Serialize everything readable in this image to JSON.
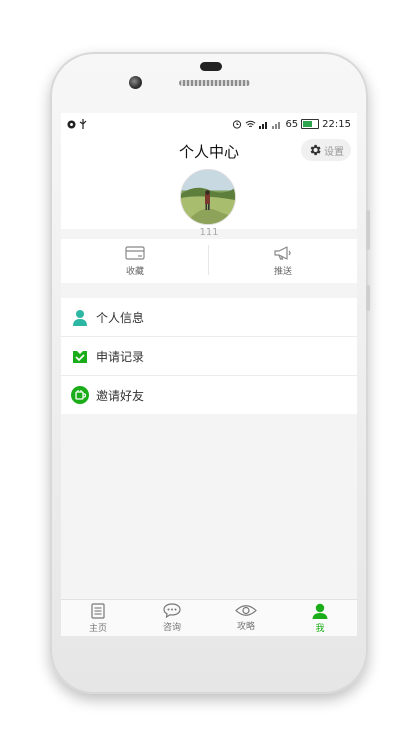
{
  "status_bar": {
    "battery_percent": "65",
    "time": "22:15",
    "battery_level": 0.65
  },
  "header": {
    "title": "个人中心",
    "settings_label": "设置"
  },
  "profile": {
    "username": "111"
  },
  "quick_actions": [
    {
      "label": "收藏",
      "icon": "card-icon"
    },
    {
      "label": "推送",
      "icon": "megaphone-icon"
    }
  ],
  "menu": [
    {
      "label": "个人信息",
      "icon": "person-icon"
    },
    {
      "label": "申请记录",
      "icon": "record-icon"
    },
    {
      "label": "邀请好友",
      "icon": "invite-icon"
    }
  ],
  "tabs": [
    {
      "label": "主页",
      "icon": "document-icon"
    },
    {
      "label": "咨询",
      "icon": "chat-icon"
    },
    {
      "label": "攻略",
      "icon": "eye-icon"
    },
    {
      "label": "我",
      "icon": "user-icon",
      "active": true
    }
  ],
  "colors": {
    "accent": "#1aad19",
    "teal": "#2bb7a3"
  }
}
